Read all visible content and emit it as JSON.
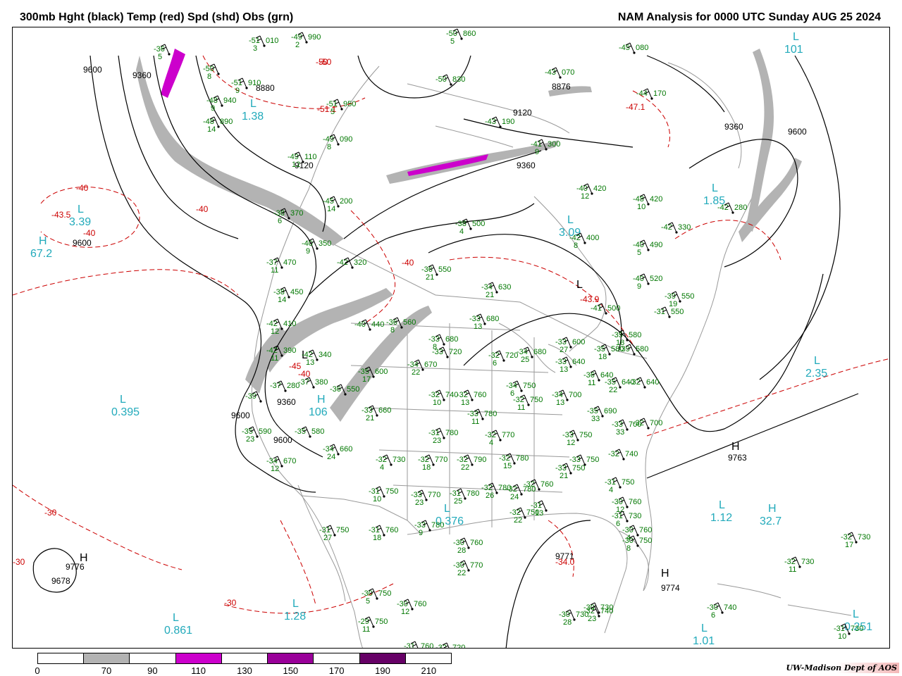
{
  "header": {
    "title_left": "300mb Hght (black) Temp (red) Spd (shd) Obs (grn)",
    "title_right": "NAM Analysis for 0000 UTC Sunday  AUG 25 2024"
  },
  "colors": {
    "height_contour": "#000000",
    "temperature_contour": "#cc0000",
    "observation_text": "#007700",
    "extrema_label": "#22aabb",
    "political_border": "#999999",
    "speed_70_90": "#b3b3b3",
    "speed_110_130": "#cc00cc",
    "speed_150_170": "#990099",
    "speed_190_210": "#660066"
  },
  "colorbar": {
    "segments": [
      "#ffffff",
      "#b3b3b3",
      "#ffffff",
      "#cc00cc",
      "#ffffff",
      "#990099",
      "#ffffff",
      "#660066",
      "#ffffff"
    ],
    "labels": [
      "0",
      "70",
      "90",
      "110",
      "130",
      "150",
      "170",
      "190",
      "210"
    ]
  },
  "credit": "UW-Madison  Dept of AOS",
  "height_labels": [
    {
      "text": "9600"
    },
    {
      "text": "9360"
    },
    {
      "text": "9120"
    },
    {
      "text": "8880"
    },
    {
      "text": "9120"
    },
    {
      "text": "9360"
    },
    {
      "text": "9360"
    },
    {
      "text": "9600"
    },
    {
      "text": "9600"
    },
    {
      "text": "9360"
    },
    {
      "text": "9600"
    },
    {
      "text": "9600"
    },
    {
      "text": "9776"
    },
    {
      "text": "9678"
    },
    {
      "text": "9763"
    },
    {
      "text": "9771"
    },
    {
      "text": "9774"
    },
    {
      "text": "8876"
    }
  ],
  "temp_labels": [
    {
      "text": "-40"
    },
    {
      "text": "-40"
    },
    {
      "text": "-43.5"
    },
    {
      "text": "-40"
    },
    {
      "text": "-50"
    },
    {
      "text": "-51.1"
    },
    {
      "text": "-47.1"
    },
    {
      "text": "-43.9"
    },
    {
      "text": "-40"
    },
    {
      "text": "-40"
    },
    {
      "text": "-45"
    },
    {
      "text": "-30"
    },
    {
      "text": "-30"
    },
    {
      "text": "-30"
    },
    {
      "text": "-34.0"
    },
    {
      "text": "-50"
    }
  ],
  "extrema": [
    {
      "letter": "L",
      "value": "3.39"
    },
    {
      "letter": "H",
      "value": "67.2"
    },
    {
      "letter": "L",
      "value": "1.38"
    },
    {
      "letter": "L",
      "value": "3.09"
    },
    {
      "letter": "L",
      "value": "1.85"
    },
    {
      "letter": "L",
      "value": "2.35"
    },
    {
      "letter": "L",
      "value": "0.395"
    },
    {
      "letter": "L",
      "value": "0.376"
    },
    {
      "letter": "L",
      "value": "1.12"
    },
    {
      "letter": "H",
      "value": "32.7"
    },
    {
      "letter": "L",
      "value": "1.28"
    },
    {
      "letter": "L",
      "value": "0.861"
    },
    {
      "letter": "L",
      "value": "1.01"
    },
    {
      "letter": "L",
      "value": "0.251"
    },
    {
      "letter": "H",
      "value": "106"
    },
    {
      "letter": "L",
      "value": "101"
    }
  ],
  "hl_markers": [
    {
      "letter": "H"
    },
    {
      "letter": "H"
    },
    {
      "letter": "L"
    },
    {
      "letter": "L"
    },
    {
      "letter": "H"
    }
  ],
  "observations": [
    {
      "t": "-51",
      "h": "010",
      "s": "3"
    },
    {
      "t": "-49",
      "h": "990",
      "s": "2"
    },
    {
      "t": "-36",
      "h": "",
      "s": "5"
    },
    {
      "t": "-50",
      "h": "",
      "s": "8"
    },
    {
      "t": "-51",
      "h": "910",
      "s": "9"
    },
    {
      "t": "-48",
      "h": "940",
      "s": "9"
    },
    {
      "t": "-48",
      "h": "890",
      "s": "14"
    },
    {
      "t": "-51",
      "h": "950",
      "s": "5"
    },
    {
      "t": "-50",
      "h": "830",
      "s": ""
    },
    {
      "t": "-50",
      "h": "860",
      "s": "5"
    },
    {
      "t": "-49",
      "h": "090",
      "s": "8"
    },
    {
      "t": "-49",
      "h": "110",
      "s": "12"
    },
    {
      "t": "-45",
      "h": "200",
      "s": "14"
    },
    {
      "t": "-38",
      "h": "370",
      "s": "6"
    },
    {
      "t": "-40",
      "h": "350",
      "s": "9"
    },
    {
      "t": "-37",
      "h": "470",
      "s": "11"
    },
    {
      "t": "-38",
      "h": "450",
      "s": "14"
    },
    {
      "t": "-42",
      "h": "320",
      "s": ""
    },
    {
      "t": "-43",
      "h": "190",
      "s": ""
    },
    {
      "t": "-41",
      "h": "300",
      "s": "9"
    },
    {
      "t": "-45",
      "h": "080",
      "s": ""
    },
    {
      "t": "-44",
      "h": "170",
      "s": ""
    },
    {
      "t": "-43",
      "h": "070",
      "s": ""
    },
    {
      "t": "-40",
      "h": "420",
      "s": "12"
    },
    {
      "t": "-48",
      "h": "420",
      "s": "10"
    },
    {
      "t": "-42",
      "h": "280",
      "s": ""
    },
    {
      "t": "-42",
      "h": "330",
      "s": ""
    },
    {
      "t": "-42",
      "h": "400",
      "s": "8"
    },
    {
      "t": "-40",
      "h": "490",
      "s": "5"
    },
    {
      "t": "-38",
      "h": "500",
      "s": "4"
    },
    {
      "t": "-36",
      "h": "550",
      "s": "21"
    },
    {
      "t": "-34",
      "h": "630",
      "s": "21"
    },
    {
      "t": "-40",
      "h": "520",
      "s": "9"
    },
    {
      "t": "-39",
      "h": "550",
      "s": "19"
    },
    {
      "t": "-41",
      "h": "500",
      "s": ""
    },
    {
      "t": "-31",
      "h": "550",
      "s": ""
    },
    {
      "t": "-33",
      "h": "680",
      "s": "13"
    },
    {
      "t": "-42",
      "h": "410",
      "s": "12"
    },
    {
      "t": "-40",
      "h": "440",
      "s": ""
    },
    {
      "t": "-36",
      "h": "560",
      "s": "8"
    },
    {
      "t": "-42",
      "h": "390",
      "s": "11"
    },
    {
      "t": "-42",
      "h": "340",
      "s": "13"
    },
    {
      "t": "-33",
      "h": "680",
      "s": "8"
    },
    {
      "t": "-33",
      "h": "720",
      "s": ""
    },
    {
      "t": "-32",
      "h": "720",
      "s": "6"
    },
    {
      "t": "-34",
      "h": "680",
      "s": "25"
    },
    {
      "t": "-33",
      "h": "600",
      "s": "27"
    },
    {
      "t": "-35",
      "h": "580",
      "s": "18"
    },
    {
      "t": "-33",
      "h": "640",
      "s": "13"
    },
    {
      "t": "-36",
      "h": "640",
      "s": "11"
    },
    {
      "t": "-35",
      "h": "640",
      "s": "22"
    },
    {
      "t": "-32",
      "h": "640",
      "s": ""
    },
    {
      "t": "-35",
      "h": "580",
      "s": "18"
    },
    {
      "t": "-39",
      "h": "580",
      "s": ""
    },
    {
      "t": "-34",
      "h": "670",
      "s": "22"
    },
    {
      "t": "-35",
      "h": "600",
      "s": "17"
    },
    {
      "t": "-37",
      "h": "380",
      "s": ""
    },
    {
      "t": "-37",
      "h": "280",
      "s": ""
    },
    {
      "t": "-36",
      "h": "550",
      "s": ""
    },
    {
      "t": "-39",
      "h": "",
      "s": ""
    },
    {
      "t": "-34",
      "h": "750",
      "s": "6"
    },
    {
      "t": "-34",
      "h": "700",
      "s": "13"
    },
    {
      "t": "-32",
      "h": "750",
      "s": "11"
    },
    {
      "t": "-35",
      "h": "690",
      "s": "33"
    },
    {
      "t": "-33",
      "h": "700",
      "s": "33"
    },
    {
      "t": "-32",
      "h": "700",
      "s": ""
    },
    {
      "t": "-32",
      "h": "740",
      "s": "10"
    },
    {
      "t": "-32",
      "h": "760",
      "s": "13"
    },
    {
      "t": "-33",
      "h": "660",
      "s": "21"
    },
    {
      "t": "-33",
      "h": "780",
      "s": "11"
    },
    {
      "t": "-31",
      "h": "780",
      "s": "23"
    },
    {
      "t": "-32",
      "h": "770",
      "s": "4"
    },
    {
      "t": "-33",
      "h": "750",
      "s": "12"
    },
    {
      "t": "-35",
      "h": "590",
      "s": "23"
    },
    {
      "t": "-35",
      "h": "580",
      "s": ""
    },
    {
      "t": "-34",
      "h": "660",
      "s": "24"
    },
    {
      "t": "-34",
      "h": "670",
      "s": "12"
    },
    {
      "t": "-32",
      "h": "730",
      "s": "4"
    },
    {
      "t": "-32",
      "h": "770",
      "s": "18"
    },
    {
      "t": "-32",
      "h": "790",
      "s": "22"
    },
    {
      "t": "-32",
      "h": "780",
      "s": "15"
    },
    {
      "t": "-33",
      "h": "750",
      "s": "21"
    },
    {
      "t": "-33",
      "h": "750",
      "s": ""
    },
    {
      "t": "-32",
      "h": "740",
      "s": ""
    },
    {
      "t": "-31",
      "h": "750",
      "s": "10"
    },
    {
      "t": "-33",
      "h": "770",
      "s": "23"
    },
    {
      "t": "-31",
      "h": "780",
      "s": "25"
    },
    {
      "t": "-32",
      "h": "780",
      "s": "26"
    },
    {
      "t": "-32",
      "h": "780",
      "s": "24"
    },
    {
      "t": "-32",
      "h": "760",
      "s": ""
    },
    {
      "t": "-32",
      "h": "750",
      "s": "22"
    },
    {
      "t": "-31",
      "h": "",
      "s": "13"
    },
    {
      "t": "-31",
      "h": "750",
      "s": "4"
    },
    {
      "t": "-30",
      "h": "760",
      "s": "12"
    },
    {
      "t": "-31",
      "h": "730",
      "s": "6"
    },
    {
      "t": "-30",
      "h": "760",
      "s": "4"
    },
    {
      "t": "-30",
      "h": "750",
      "s": "8"
    },
    {
      "t": "-31",
      "h": "750",
      "s": "27"
    },
    {
      "t": "-31",
      "h": "760",
      "s": "18"
    },
    {
      "t": "-33",
      "h": "780",
      "s": "9"
    },
    {
      "t": "-30",
      "h": "760",
      "s": "28"
    },
    {
      "t": "-30",
      "h": "770",
      "s": "22"
    },
    {
      "t": "-30",
      "h": "750",
      "s": "5"
    },
    {
      "t": "-30",
      "h": "760",
      "s": "12"
    },
    {
      "t": "-29",
      "h": "750",
      "s": "11"
    },
    {
      "t": "-30",
      "h": "730",
      "s": ""
    },
    {
      "t": "-31",
      "h": "760",
      "s": ""
    },
    {
      "t": "-32",
      "h": "720",
      "s": ""
    },
    {
      "t": "-32",
      "h": "740",
      "s": "23"
    },
    {
      "t": "-30",
      "h": "730",
      "s": "28"
    },
    {
      "t": "-30",
      "h": "740",
      "s": "6"
    },
    {
      "t": "-32",
      "h": "730",
      "s": "17"
    },
    {
      "t": "-32",
      "h": "730",
      "s": "11"
    },
    {
      "t": "-31",
      "h": "730",
      "s": "10"
    }
  ]
}
